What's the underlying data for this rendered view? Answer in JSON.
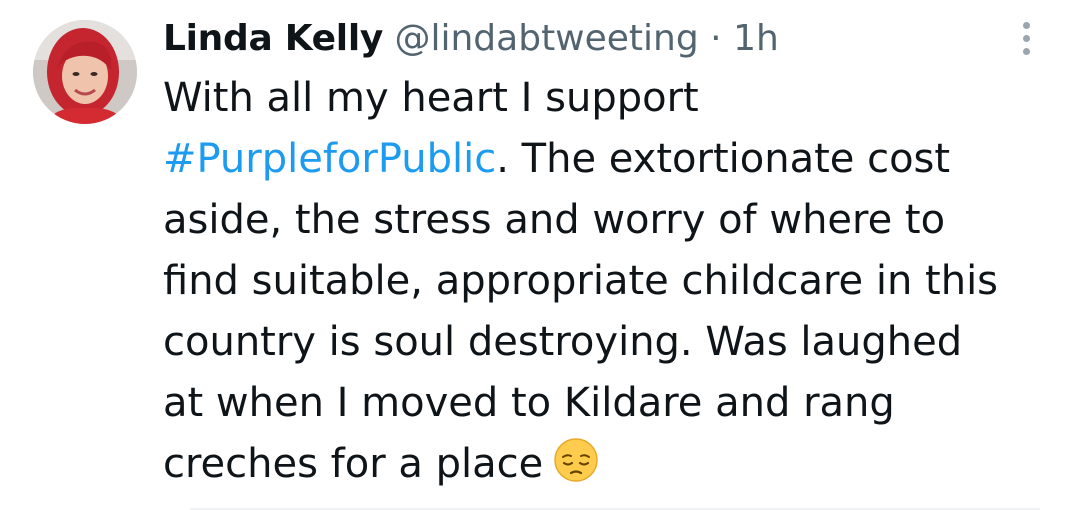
{
  "tweet": {
    "author_name": "Linda Kelly",
    "handle": "@lindabtweeting",
    "separator": "·",
    "time": "1h",
    "body_lines": [
      {
        "text": "With all my heart I support"
      },
      {
        "hashtag": "#PurpleforPublic",
        "rest": ".  The extortionate cost"
      },
      {
        "text": "aside, the stress and worry of where to"
      },
      {
        "text": "find suitable, appropriate childcare in this"
      },
      {
        "text": "country is soul destroying. Was laughed"
      },
      {
        "text": "at when I moved to Kildare and rang"
      },
      {
        "text": "creches for a place"
      }
    ],
    "emoji": "pensive-face",
    "hashtag_color": "#1d9bf0"
  }
}
